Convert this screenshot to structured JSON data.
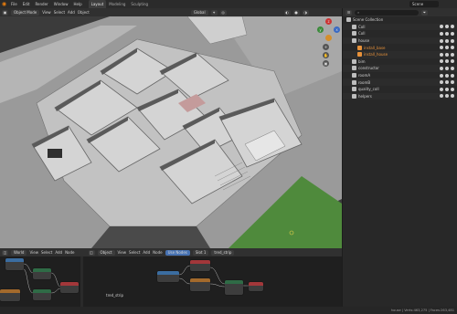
{
  "app": {
    "menu": [
      "File",
      "Edit",
      "Render",
      "Window",
      "Help"
    ],
    "workspaces": [
      {
        "label": "Layout",
        "active": true
      },
      {
        "label": "Modeling",
        "active": false
      },
      {
        "label": "Sculpting",
        "active": false
      }
    ],
    "scene": "Scene"
  },
  "viewport_header": {
    "mode": "Object Mode",
    "menus": [
      "View",
      "Select",
      "Add",
      "Object"
    ],
    "orientation": "Global"
  },
  "outliner": {
    "header": "Scene Collection",
    "rows": [
      {
        "indent": 0,
        "label": "Scene Collection",
        "icon": "collection-icon",
        "color": "#cfcfcf"
      },
      {
        "indent": 1,
        "label": "Coll",
        "icon": "collection-icon",
        "color": "#cfcfcf"
      },
      {
        "indent": 1,
        "label": "Coll",
        "icon": "collection-icon",
        "color": "#cfcfcf"
      },
      {
        "indent": 1,
        "label": "house",
        "icon": "collection-icon",
        "color": "#cfcfcf"
      },
      {
        "indent": 2,
        "label": "install_base",
        "icon": "object-icon",
        "color": "#e8923a"
      },
      {
        "indent": 2,
        "label": "install_house",
        "icon": "object-icon",
        "color": "#e8923a"
      },
      {
        "indent": 1,
        "label": "bim",
        "icon": "collection-icon",
        "color": "#cfcfcf"
      },
      {
        "indent": 1,
        "label": "constructor",
        "icon": "collection-icon",
        "color": "#cfcfcf"
      },
      {
        "indent": 1,
        "label": "roomA",
        "icon": "collection-icon",
        "color": "#cfcfcf"
      },
      {
        "indent": 1,
        "label": "roomB",
        "icon": "collection-icon",
        "color": "#cfcfcf"
      },
      {
        "indent": 1,
        "label": "quality_coll",
        "icon": "collection-icon",
        "color": "#cfcfcf"
      },
      {
        "indent": 1,
        "label": "helpers",
        "icon": "collection-icon",
        "color": "#cfcfcf"
      }
    ]
  },
  "node_editor": {
    "left_header": {
      "type": "World",
      "menus": [
        "View",
        "Select",
        "Add",
        "Node"
      ]
    },
    "right_header": {
      "type": "Object",
      "menus": [
        "View",
        "Select",
        "Add",
        "Node"
      ],
      "use_nodes": "Use Nodes",
      "slot": "Slot 1",
      "material": "tred_strip"
    },
    "labels": [
      "tred_strip"
    ]
  },
  "status": {
    "left": "",
    "right": "house | Verts:463,275 | Faces:263,481"
  },
  "colors": {
    "accent": "#4772b3",
    "node_green": "#2f6b46",
    "node_red": "#a2373a",
    "node_blue": "#3b6da0",
    "grass": "#4f8a3c"
  }
}
